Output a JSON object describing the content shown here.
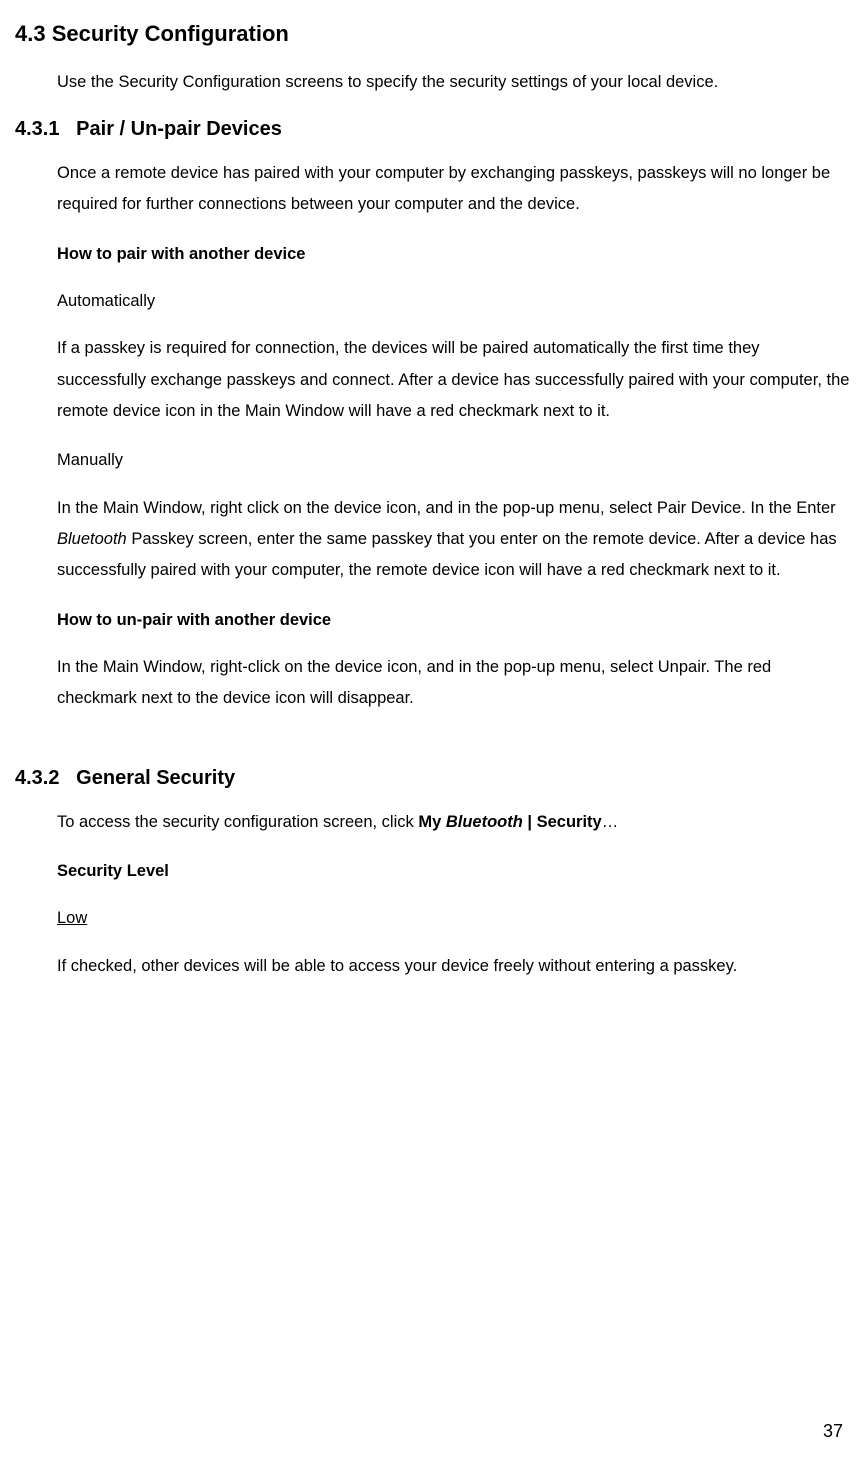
{
  "section": {
    "number": "4.3",
    "title": "Security Configuration",
    "intro": "Use the Security Configuration screens to specify the security settings of your local device."
  },
  "sub1": {
    "number": "4.3.1",
    "title": "Pair / Un-pair Devices",
    "intro": "Once a remote device has paired with your computer by exchanging passkeys, passkeys will no longer be required for further connections between your computer and the device.",
    "pair_heading": "How to pair with another device",
    "auto_label": "Automatically",
    "auto_text": "If a passkey is required for connection, the devices will be paired automatically the first time they successfully exchange passkeys and connect. After a device has successfully paired with your computer, the remote device icon in the Main Window will have a red checkmark next to it.",
    "manual_label": "Manually",
    "manual_text_pre": "In the Main Window, right click on the device icon, and in the pop-up menu, select Pair Device. In the Enter ",
    "manual_text_italic": "Bluetooth",
    "manual_text_post": " Passkey screen, enter the same passkey that you enter on the remote device. After a device has successfully paired with your computer, the remote device icon will have a red checkmark next to it.",
    "unpair_heading": "How to un-pair with another device",
    "unpair_text": "In the Main Window, right-click on the device icon, and in the pop-up menu, select Unpair. The red checkmark next to the device icon will disappear."
  },
  "sub2": {
    "number": "4.3.2",
    "title": "General Security",
    "intro_pre": "To access the security configuration screen, click ",
    "intro_bold1": "My ",
    "intro_bolditalic": "Bluetooth",
    "intro_bold2": " | Security",
    "intro_post": "…",
    "level_heading": "Security Level",
    "low_label": "Low",
    "low_text": "If checked, other devices will be able to access your device freely without entering a passkey."
  },
  "page_number": "37"
}
